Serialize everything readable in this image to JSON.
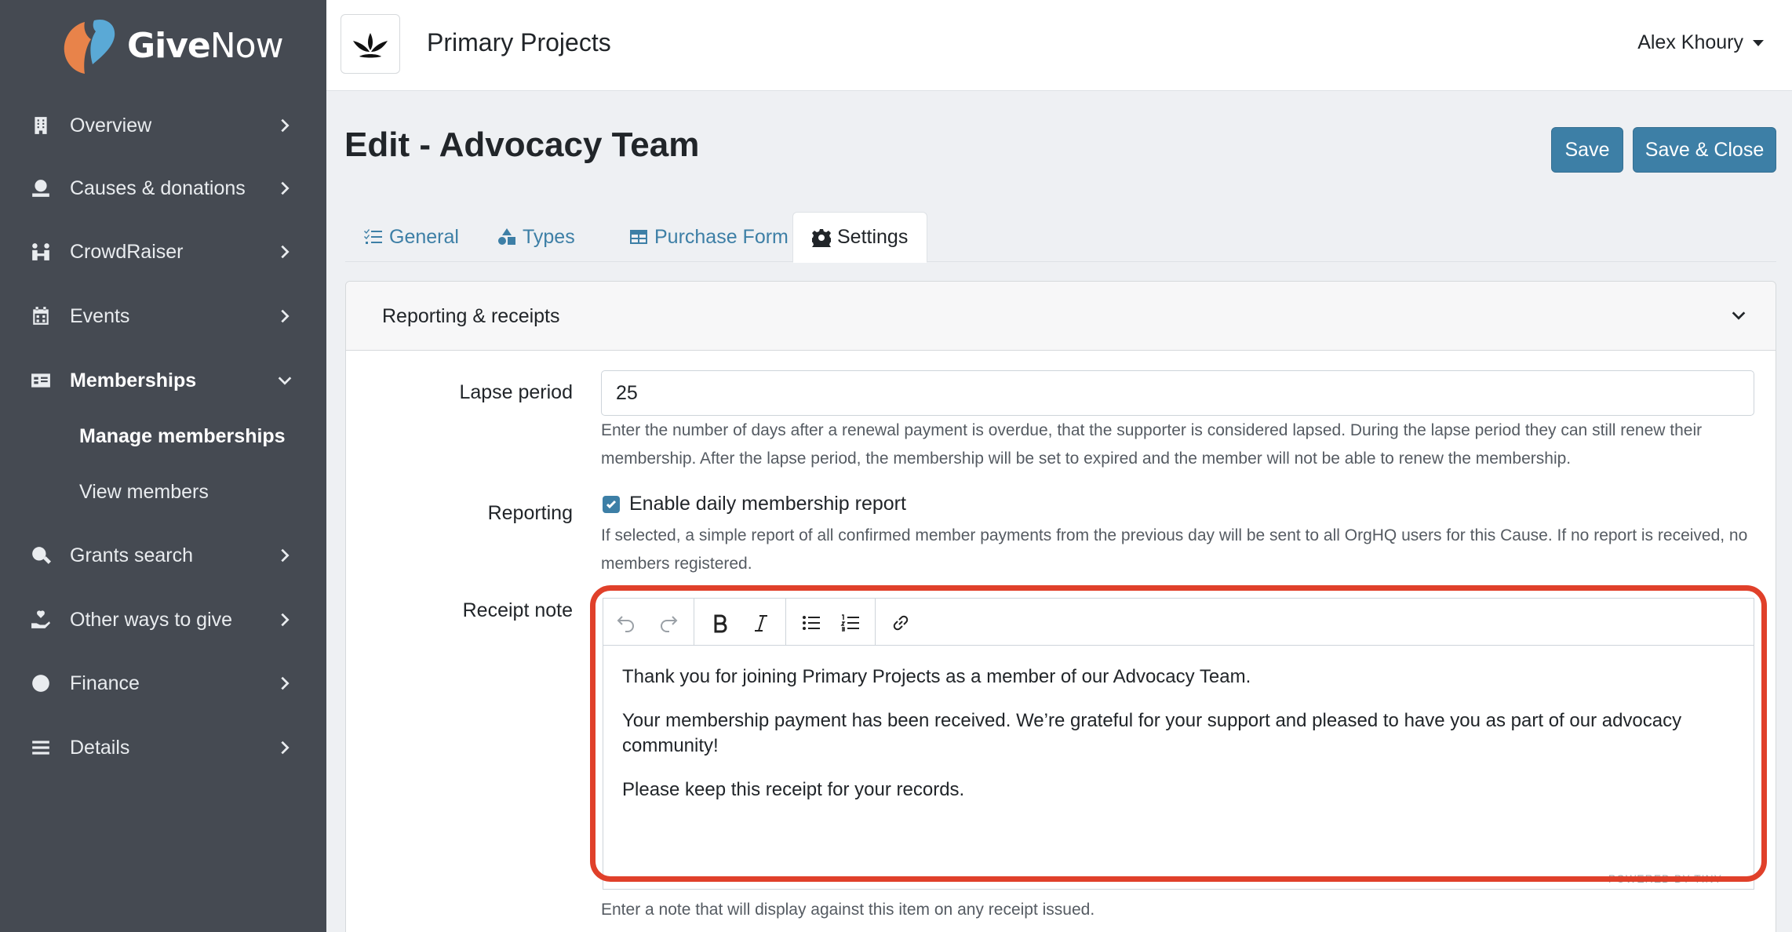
{
  "brand": {
    "give": "Give",
    "now": "Now"
  },
  "sidebar": {
    "items": [
      {
        "label": "Overview",
        "icon": "building-icon"
      },
      {
        "label": "Causes & donations",
        "icon": "donation-icon"
      },
      {
        "label": "CrowdRaiser",
        "icon": "people-icon"
      },
      {
        "label": "Events",
        "icon": "calendar-icon"
      },
      {
        "label": "Memberships",
        "icon": "id-card-icon",
        "active": true
      },
      {
        "label": "Grants search",
        "icon": "search-dollar-icon"
      },
      {
        "label": "Other ways to give",
        "icon": "hand-heart-icon"
      },
      {
        "label": "Finance",
        "icon": "coin-icon"
      },
      {
        "label": "Details",
        "icon": "list-icon"
      }
    ],
    "sub_items": [
      {
        "label": "Manage memberships",
        "active": true
      },
      {
        "label": "View members"
      }
    ]
  },
  "header": {
    "org_name": "Primary Projects",
    "user_name": "Alex Khoury"
  },
  "page": {
    "title": "Edit - Advocacy Team"
  },
  "actions": {
    "save": "Save",
    "save_close": "Save & Close"
  },
  "tabs": [
    {
      "label": "General"
    },
    {
      "label": "Types"
    },
    {
      "label": "Purchase Form"
    },
    {
      "label": "Settings",
      "active": true
    }
  ],
  "section": {
    "title": "Reporting & receipts"
  },
  "fields": {
    "lapse": {
      "label": "Lapse period",
      "value": "25",
      "help": "Enter the number of days after a renewal payment is overdue, that the supporter is considered lapsed. During the lapse period they can still renew their membership. After the lapse period, the membership will be set to expired and the member will not be able to renew the membership."
    },
    "reporting": {
      "label": "Reporting",
      "checkbox_label": "Enable daily membership report",
      "checked": true,
      "help": "If selected, a simple report of all confirmed member payments from the previous day will be sent to all OrgHQ users for this Cause. If no report is received, no members registered."
    },
    "receipt": {
      "label": "Receipt note",
      "paragraphs": [
        "Thank you for joining Primary Projects as a member of our Advocacy Team.",
        "Your membership payment has been received. We’re grateful for your support and pleased to have you as part of our advocacy community!",
        "Please keep this receipt for your records."
      ],
      "powered": "POWERED BY TINY",
      "help": "Enter a note that will display against this item on any receipt issued."
    }
  },
  "colors": {
    "sidebar": "#454a52",
    "accent": "#3d7fa6",
    "highlight": "#e0402a"
  }
}
